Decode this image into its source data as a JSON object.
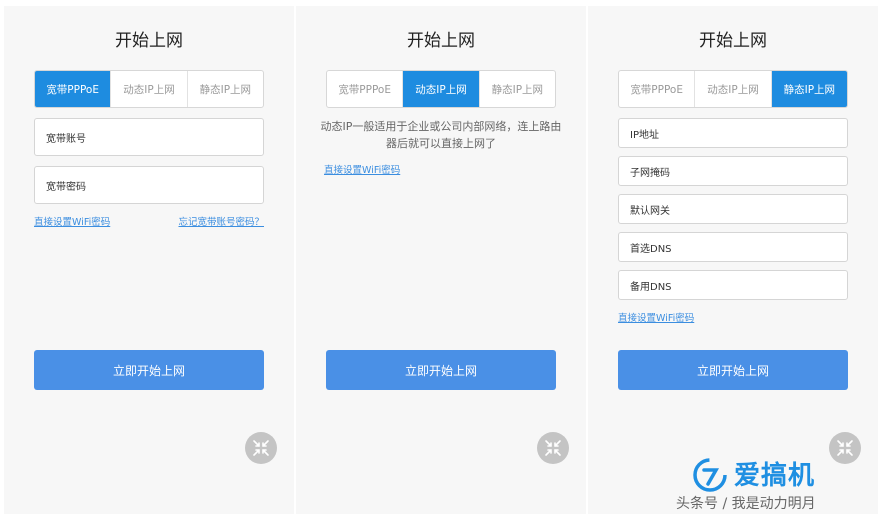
{
  "panel1": {
    "title": "开始上网",
    "tabs": [
      "宽带PPPoE",
      "动态IP上网",
      "静态IP上网"
    ],
    "fields": [
      "宽带账号",
      "宽带密码"
    ],
    "link_wifi": "直接设置WiFi密码",
    "link_forgot": "忘记宽带账号密码？",
    "submit": "立即开始上网"
  },
  "panel2": {
    "title": "开始上网",
    "tabs": [
      "宽带PPPoE",
      "动态IP上网",
      "静态IP上网"
    ],
    "description": "动态IP一般适用于企业或公司内部网络，连上路由器后就可以直接上网了",
    "link_wifi": "直接设置WiFi密码",
    "submit": "立即开始上网"
  },
  "panel3": {
    "title": "开始上网",
    "tabs": [
      "宽带PPPoE",
      "动态IP上网",
      "静态IP上网"
    ],
    "fields": [
      "IP地址",
      "子网掩码",
      "默认网关",
      "首选DNS",
      "备用DNS"
    ],
    "link_wifi": "直接设置WiFi密码",
    "submit": "立即开始上网"
  },
  "watermark": {
    "brand": "爱搞机",
    "credit": "头条号 / 我是动力明月"
  },
  "colors": {
    "accent": "#1e8ce0",
    "button": "#4a90e6",
    "link": "#3b8ee0",
    "fab": "#c4c4c4"
  },
  "icons": {
    "shrink": "collapse-arrows-icon",
    "logo": "aigaoji-logo-icon"
  }
}
